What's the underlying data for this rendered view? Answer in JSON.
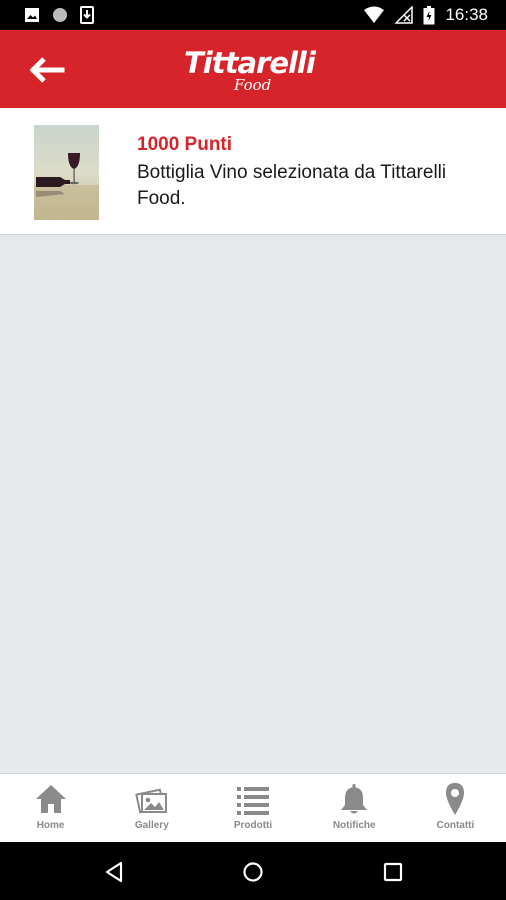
{
  "status_bar": {
    "time": "16:38"
  },
  "header": {
    "logo_main": "Tittarelli",
    "logo_sub": "Food",
    "brand_color": "#d7242b"
  },
  "reward": {
    "points": "1000 Punti",
    "description": "Bottiglia Vino selezionata da Tittarelli Food."
  },
  "tabs": [
    {
      "label": "Home",
      "icon": "home-icon"
    },
    {
      "label": "Gallery",
      "icon": "gallery-icon"
    },
    {
      "label": "Prodotti",
      "icon": "list-icon"
    },
    {
      "label": "Notifiche",
      "icon": "bell-icon"
    },
    {
      "label": "Contatti",
      "icon": "location-pin-icon"
    }
  ],
  "colors": {
    "tab_icon": "#8a8a8a",
    "background": "#e6e9eb"
  }
}
